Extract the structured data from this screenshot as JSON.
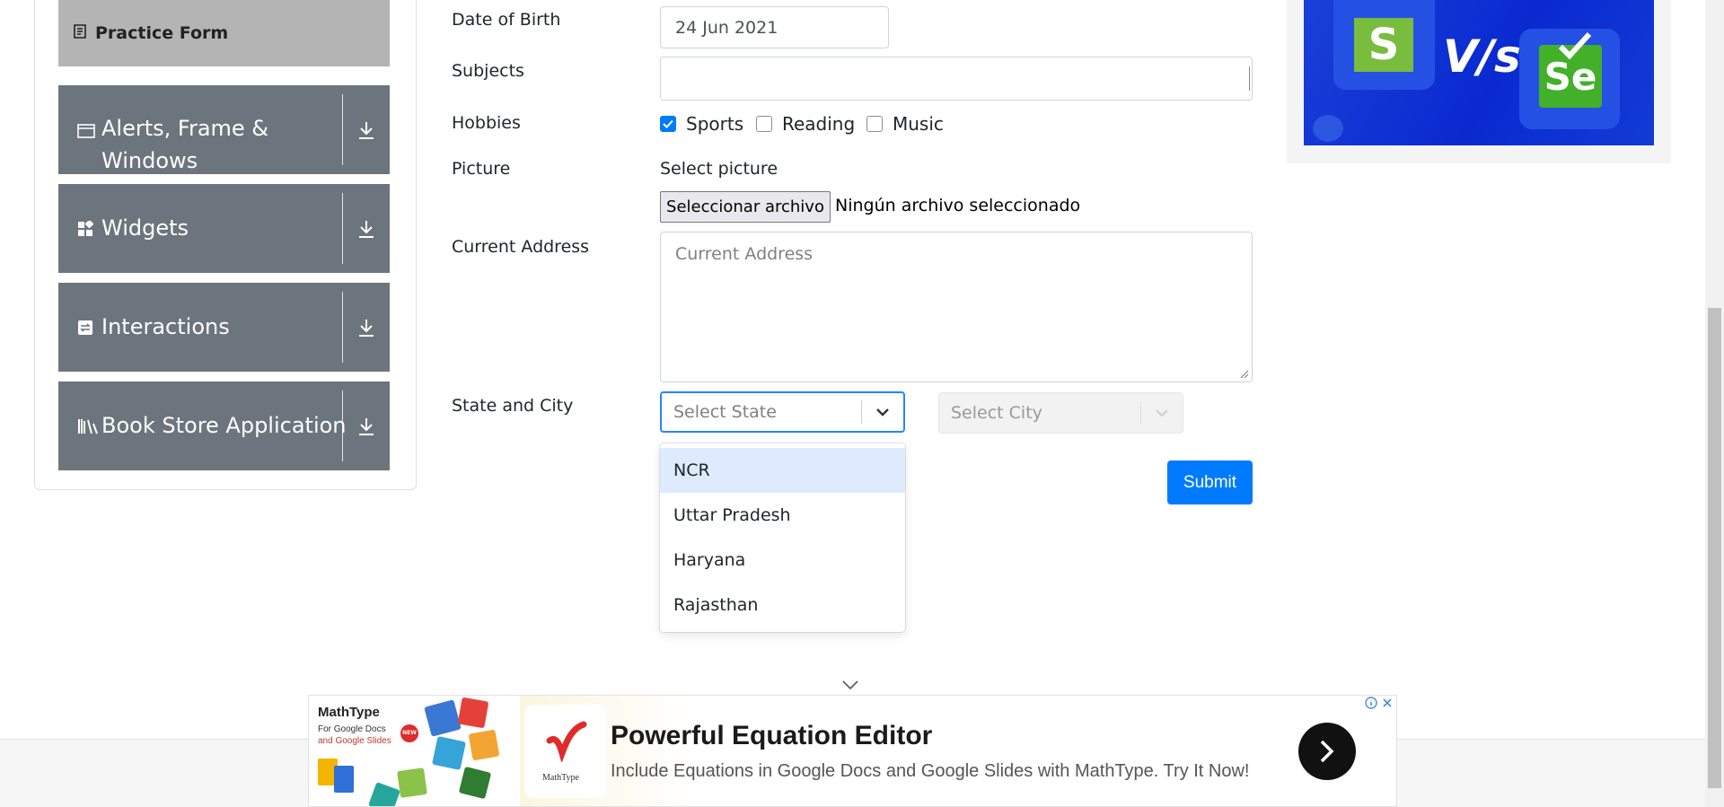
{
  "sidebar": {
    "practice_form": "Practice Form",
    "groups": [
      {
        "label_line1": "Alerts, Frame &",
        "label_line2": "Windows",
        "icon": "window-icon"
      },
      {
        "label": "Widgets",
        "icon": "widgets-icon"
      },
      {
        "label": "Interactions",
        "icon": "interactions-icon"
      },
      {
        "label": "Book Store Application",
        "icon": "books-icon"
      }
    ]
  },
  "form": {
    "dob_label": "Date of Birth",
    "dob_value": "24 Jun 2021",
    "subjects_label": "Subjects",
    "hobbies_label": "Hobbies",
    "hobbies": [
      {
        "label": "Sports",
        "checked": true
      },
      {
        "label": "Reading",
        "checked": false
      },
      {
        "label": "Music",
        "checked": false
      }
    ],
    "picture_label": "Picture",
    "select_picture": "Select picture",
    "file_button": "Seleccionar archivo",
    "file_status": "Ningún archivo seleccionado",
    "address_label": "Current Address",
    "address_placeholder": "Current Address",
    "state_city_label": "State and City",
    "state_placeholder": "Select State",
    "city_placeholder": "Select City",
    "state_options": [
      "NCR",
      "Uttar Pradesh",
      "Haryana",
      "Rajasthan"
    ],
    "submit": "Submit"
  },
  "ad_top": {
    "left_logo": "S",
    "vs": "V/s",
    "right_logo": "Se"
  },
  "banner": {
    "brand": "MathType",
    "brand_sub_1": "For Google Docs",
    "brand_sub_2": "and Google Slides",
    "new_badge": "NEW",
    "mini_logo_text": "MathType",
    "title": "Powerful Equation Editor",
    "subtitle": "Include Equations in Google Docs and Google Slides with MathType. Try It Now!"
  },
  "colors": {
    "primary": "#007bff",
    "sidebar_group": "#6c757d",
    "sidebar_active": "#b4b4b4"
  }
}
